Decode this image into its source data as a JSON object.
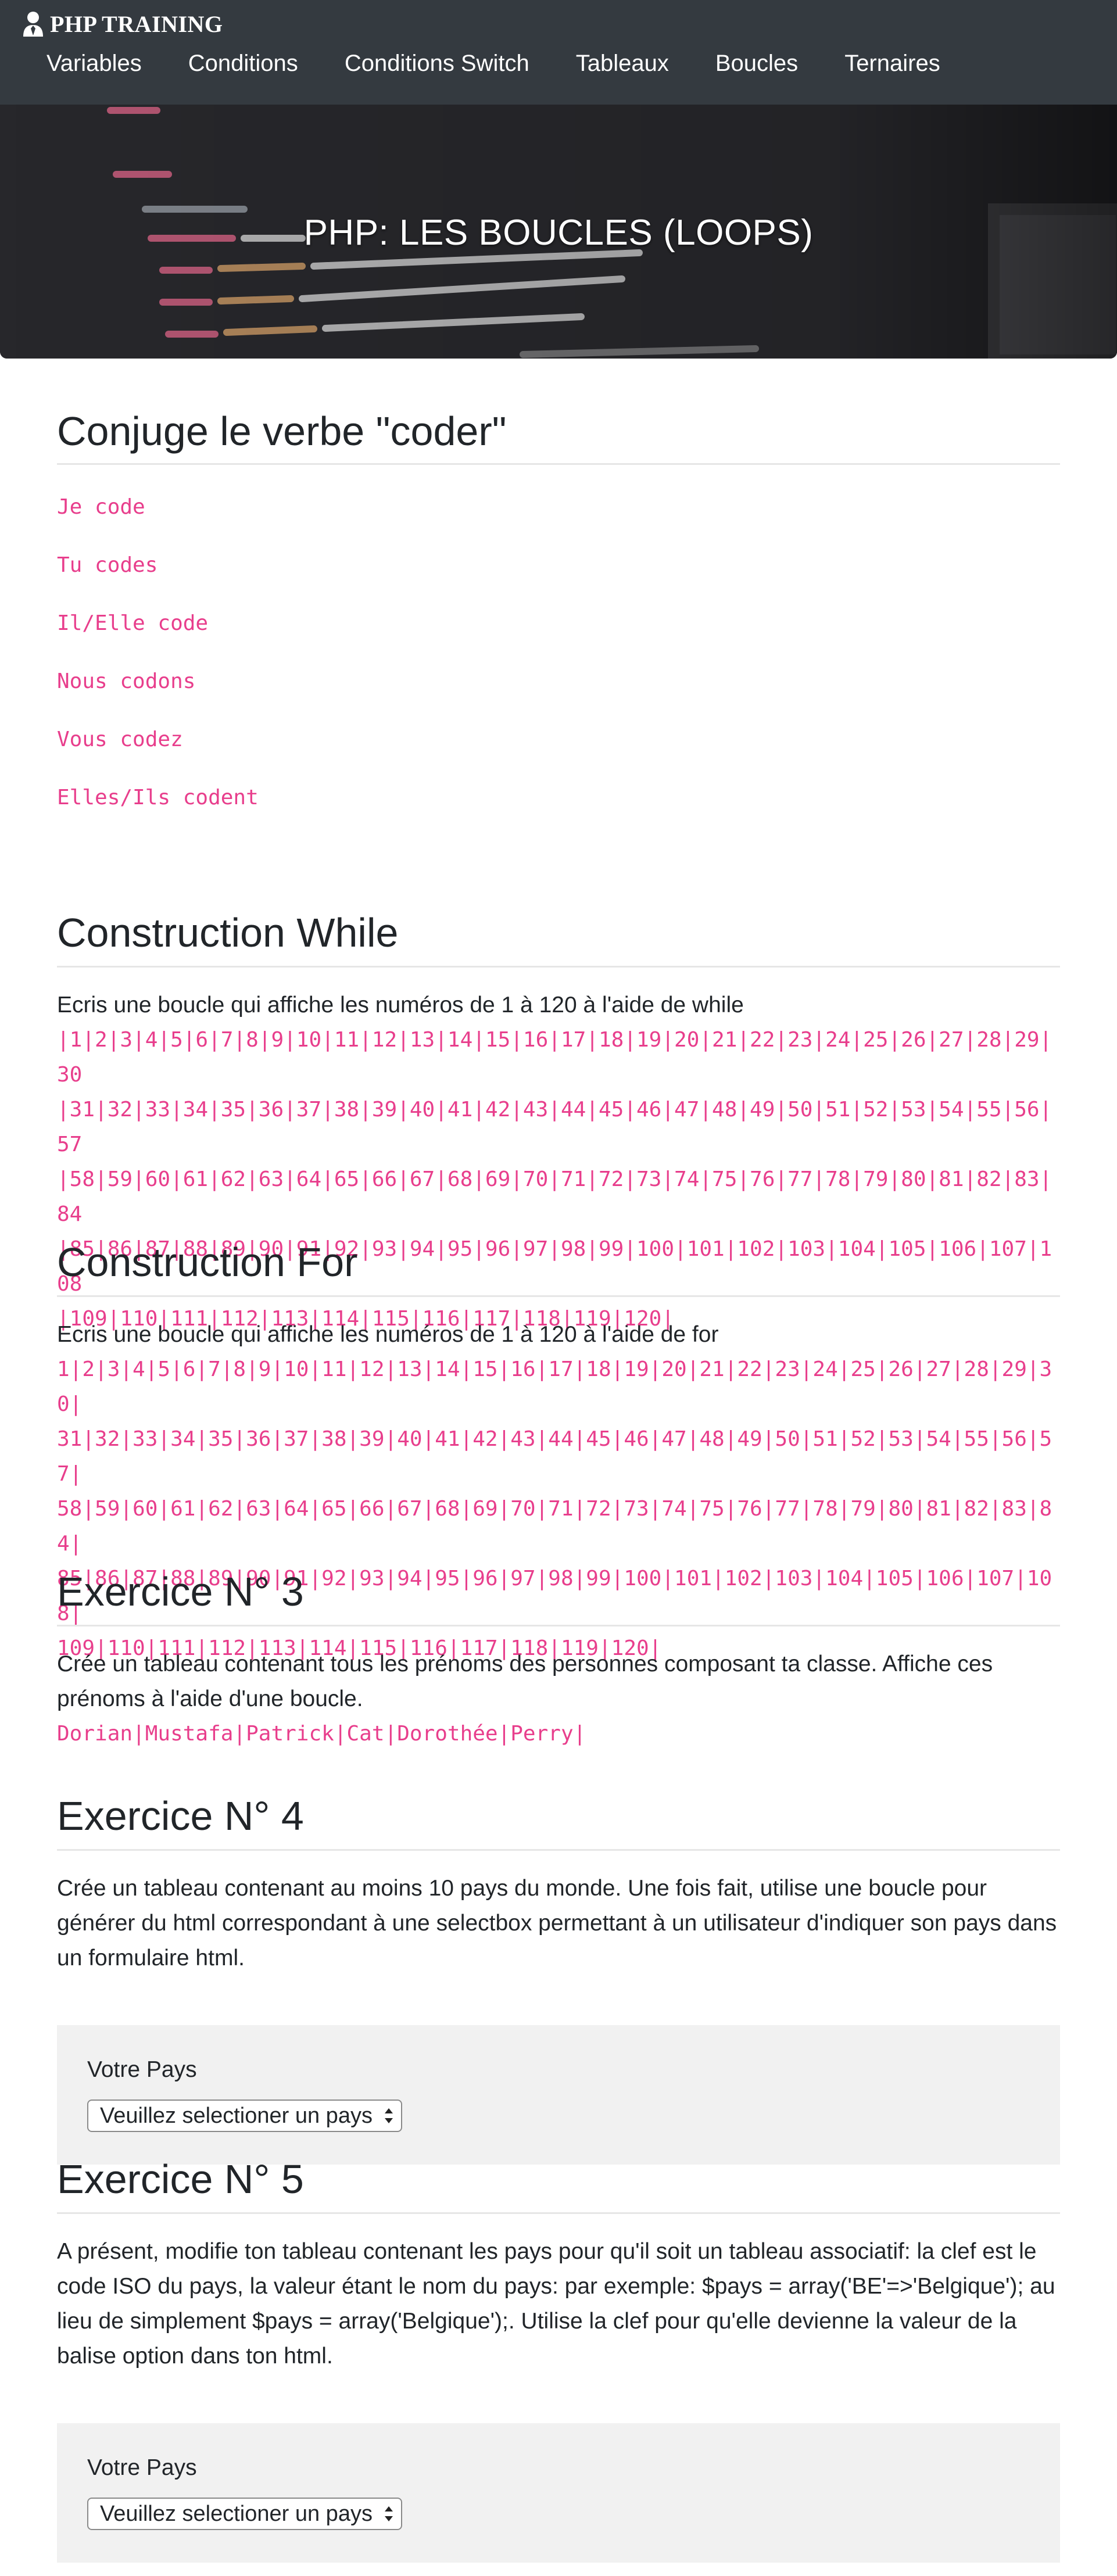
{
  "brand": {
    "title": "PHP TRAINING",
    "icon": "user-icon"
  },
  "nav": [
    "Variables",
    "Conditions",
    "Conditions Switch",
    "Tableaux",
    "Boucles",
    "Ternaires"
  ],
  "hero": {
    "title": "PHP: LES BOUCLES (LOOPS)"
  },
  "conjugaison": {
    "title": "Conjuge le verbe \"coder\"",
    "lines": [
      "Je code",
      "Tu codes",
      "Il/Elle code",
      "Nous codons",
      "Vous codez",
      "Elles/Ils codent"
    ]
  },
  "while_section": {
    "title": "Construction While",
    "description": "Ecris une boucle qui affiche les numéros de 1 à 120 à l'aide de while",
    "lines": [
      "|1|2|3|4|5|6|7|8|9|10|11|12|13|14|15|16|17|18|19|20|21|22|23|24|25|26|27|28|29|30",
      "|31|32|33|34|35|36|37|38|39|40|41|42|43|44|45|46|47|48|49|50|51|52|53|54|55|56|57",
      "|58|59|60|61|62|63|64|65|66|67|68|69|70|71|72|73|74|75|76|77|78|79|80|81|82|83|84",
      "|85|86|87|88|89|90|91|92|93|94|95|96|97|98|99|100|101|102|103|104|105|106|107|108",
      "|109|110|111|112|113|114|115|116|117|118|119|120|"
    ]
  },
  "for_section": {
    "title": "Construction For",
    "description": "Ecris une boucle qui affiche les numéros de 1 à 120 à l'aide de for",
    "lines": [
      "1|2|3|4|5|6|7|8|9|10|11|12|13|14|15|16|17|18|19|20|21|22|23|24|25|26|27|28|29|30|",
      "31|32|33|34|35|36|37|38|39|40|41|42|43|44|45|46|47|48|49|50|51|52|53|54|55|56|57|",
      "58|59|60|61|62|63|64|65|66|67|68|69|70|71|72|73|74|75|76|77|78|79|80|81|82|83|84|",
      "85|86|87|88|89|90|91|92|93|94|95|96|97|98|99|100|101|102|103|104|105|106|107|108|",
      "109|110|111|112|113|114|115|116|117|118|119|120|"
    ]
  },
  "exercice3": {
    "title": "Exercice N° 3",
    "description_lines": [
      "Crée un tableau contenant tous les prénoms des personnes composant ta classe. Affiche ces",
      "prénoms à l'aide d'une boucle."
    ],
    "output": "Dorian|Mustafa|Patrick|Cat|Dorothée|Perry|"
  },
  "exercice4": {
    "title": "Exercice N° 4",
    "description_lines": [
      "Crée un tableau contenant au moins 10 pays du monde. Une fois fait, utilise une boucle pour",
      "générer du html correspondant à une selectbox permettant à un utilisateur d'indiquer son pays dans",
      "un formulaire html."
    ],
    "form": {
      "label": "Votre Pays",
      "select_value": "Veuillez selectioner un pays"
    }
  },
  "exercice5": {
    "title": "Exercice N° 5",
    "description_lines": [
      "A présent, modifie ton tableau contenant les pays pour qu'il soit un tableau associatif: la clef est le",
      "code ISO du pays, la valeur étant le nom du pays: par exemple: $pays = array('BE'=>'Belgique'); au",
      "lieu de simplement $pays = array('Belgique');. Utilise la clef pour qu'elle devienne la valeur de la",
      "balise option dans ton html."
    ],
    "form": {
      "label": "Votre Pays",
      "select_value": "Veuillez selectioner un pays"
    }
  },
  "colors": {
    "navbar": "#343a40",
    "code": "#e83e8c",
    "form_bg": "#f1f1f1",
    "divider": "#e6e6e6"
  }
}
